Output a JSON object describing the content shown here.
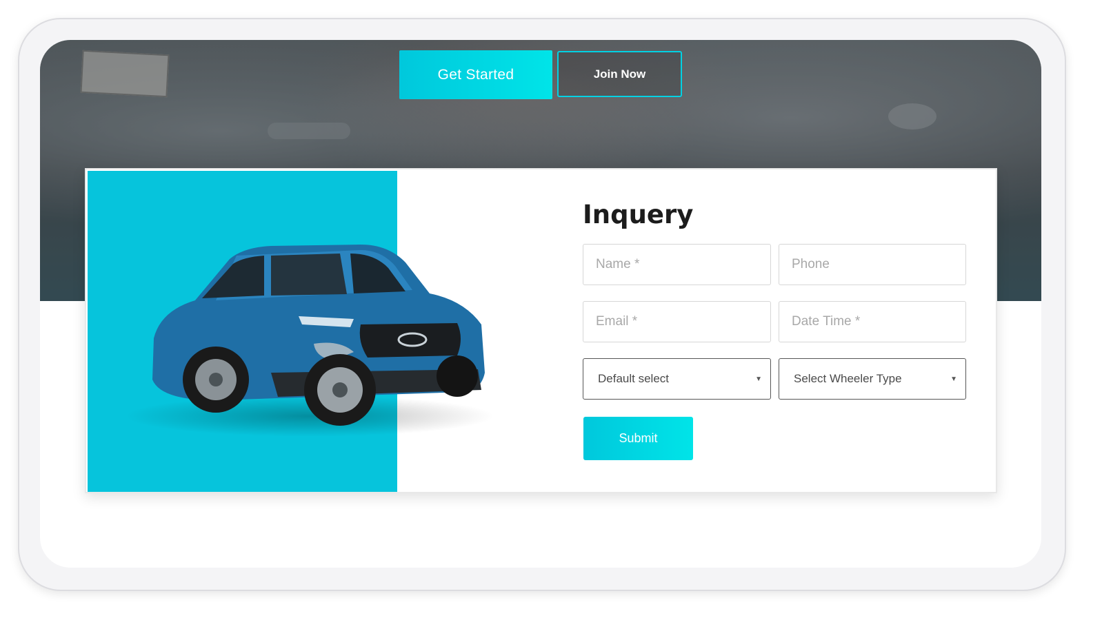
{
  "hero": {
    "get_started_label": "Get Started",
    "join_now_label": "Join Now"
  },
  "inquiry": {
    "title": "Inquery",
    "fields": {
      "name_placeholder": "Name *",
      "phone_placeholder": "Phone",
      "email_placeholder": "Email *",
      "datetime_placeholder": "Date Time *"
    },
    "selects": {
      "default_select_value": "Default select",
      "wheeler_type_value": "Select Wheeler Type"
    },
    "submit_label": "Submit"
  },
  "colors": {
    "accent": "#06c4dc",
    "accent_light": "#00e4e8",
    "car_body": "#1f6fa6"
  },
  "icons": {
    "select_arrow": "chevron-down-icon"
  }
}
